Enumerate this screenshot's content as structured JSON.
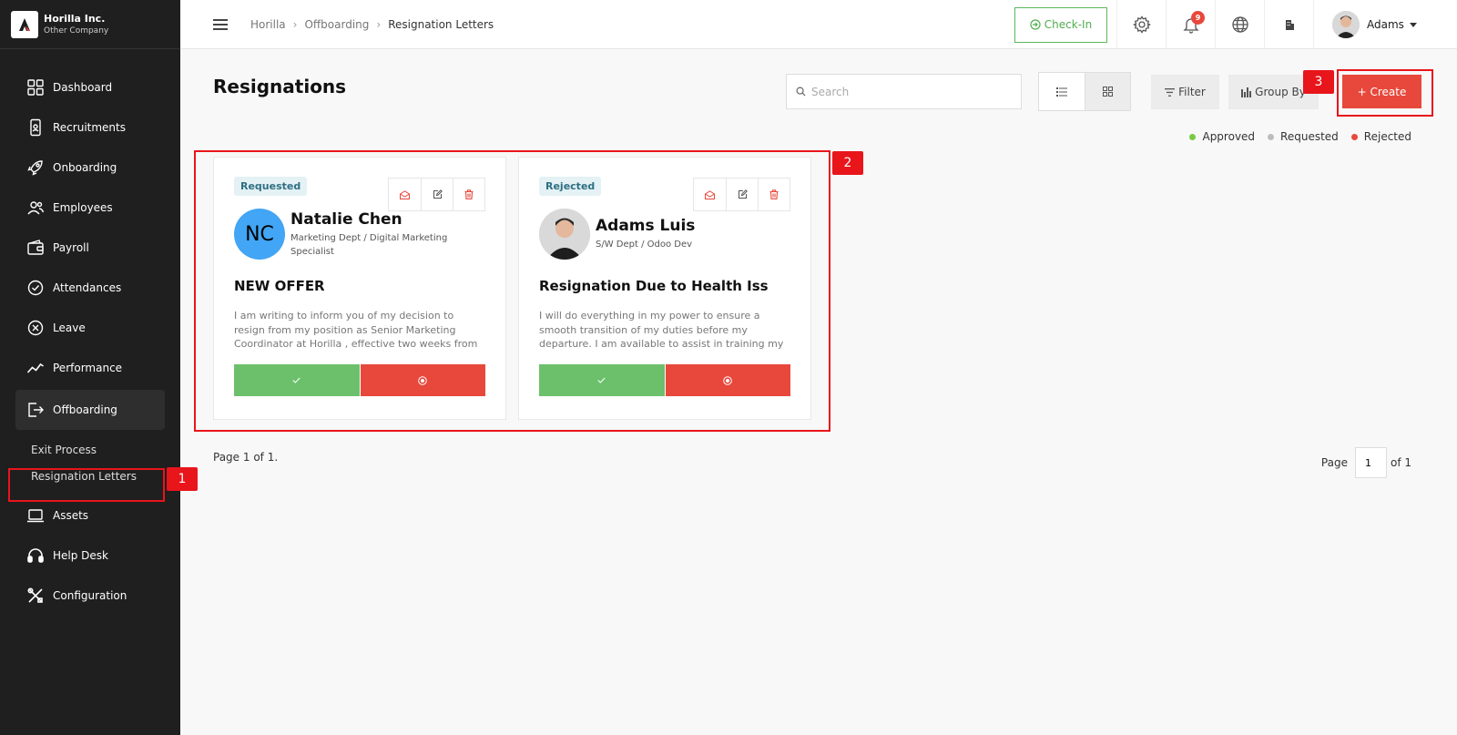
{
  "brand": {
    "company": "Horilla Inc.",
    "sub": "Other Company"
  },
  "sidebar": {
    "items": [
      {
        "label": "Dashboard",
        "icon": "dashboard-icon"
      },
      {
        "label": "Recruitments",
        "icon": "recruitment-icon"
      },
      {
        "label": "Onboarding",
        "icon": "rocket-icon"
      },
      {
        "label": "Employees",
        "icon": "employees-icon"
      },
      {
        "label": "Payroll",
        "icon": "wallet-icon"
      },
      {
        "label": "Attendances",
        "icon": "attendance-icon"
      },
      {
        "label": "Leave",
        "icon": "leave-icon"
      },
      {
        "label": "Performance",
        "icon": "performance-icon"
      },
      {
        "label": "Offboarding",
        "icon": "offboarding-icon"
      },
      {
        "label": "Assets",
        "icon": "laptop-icon"
      },
      {
        "label": "Help Desk",
        "icon": "headset-icon"
      },
      {
        "label": "Configuration",
        "icon": "tools-icon"
      }
    ],
    "subitems": [
      "Exit Process",
      "Resignation Letters"
    ]
  },
  "breadcrumb": [
    "Horilla",
    "Offboarding",
    "Resignation Letters"
  ],
  "topbar": {
    "checkin": "Check-In",
    "notifications": "9",
    "user": "Adams"
  },
  "page": {
    "title": "Resignations"
  },
  "toolbar": {
    "search_placeholder": "Search",
    "filter": "Filter",
    "groupby": "Group By",
    "create": "+ Create"
  },
  "legend": [
    {
      "label": "Approved",
      "color": "#7ac943"
    },
    {
      "label": "Requested",
      "color": "#bdbdbd"
    },
    {
      "label": "Rejected",
      "color": "#e8473b"
    }
  ],
  "cards": [
    {
      "status": "Requested",
      "initials": "NC",
      "name": "Natalie Chen",
      "dept": "Marketing Dept / Digital Marketing Specialist",
      "title": "NEW OFFER",
      "body": "I am writing to inform you of my decision to resign from my position as Senior Marketing Coordinator at Horilla , effective two weeks from today, [Last Working Day] as is customary for notice of"
    },
    {
      "status": "Rejected",
      "initials": "",
      "name": "Adams Luis",
      "dept": "S/W Dept / Odoo Dev",
      "title": "Resignation Due to Health Iss",
      "body": "I will do everything in my power to ensure a smooth transition of my duties before my departure. I am available to assist in training my replacement and providing"
    }
  ],
  "pagination": {
    "info": "Page 1 of 1.",
    "label": "Page",
    "current": "1",
    "of": "of 1"
  },
  "annotations": [
    "1",
    "2",
    "3"
  ]
}
